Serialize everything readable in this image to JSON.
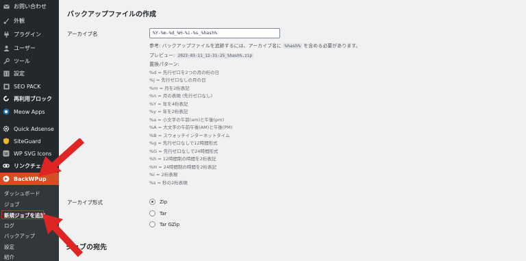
{
  "sidebar": {
    "items": [
      {
        "label": "お問い合わせ",
        "icon": "mail-icon"
      },
      {
        "label": "外観",
        "icon": "brush-icon"
      },
      {
        "label": "プラグイン",
        "icon": "plugin-icon"
      },
      {
        "label": "ユーザー",
        "icon": "user-icon"
      },
      {
        "label": "ツール",
        "icon": "wrench-icon"
      },
      {
        "label": "設定",
        "icon": "settings-icon"
      },
      {
        "label": "SEO PACK",
        "icon": "seo-icon"
      },
      {
        "label": "再利用ブロック",
        "icon": "reuse-icon"
      },
      {
        "label": "Meow Apps",
        "icon": "meow-icon"
      },
      {
        "label": "Quick Adsense",
        "icon": "gear-icon"
      },
      {
        "label": "SiteGuard",
        "icon": "shield-icon"
      },
      {
        "label": "WP SVG Icons",
        "icon": "svg-icon"
      },
      {
        "label": "リンクチェッカー",
        "icon": "link-icon"
      },
      {
        "label": "BackWPup",
        "icon": "backwpup-icon"
      }
    ],
    "submenu": [
      "ダッシュボード",
      "ジョブ",
      "新規ジョブを追加",
      "ログ",
      "バックアップ",
      "設定",
      "紹介"
    ]
  },
  "main": {
    "section_title": "バックアップファイルの作成",
    "archive_name_label": "アーカイブ名",
    "archive_name_value": "%Y-%m-%d_%H-%i-%s_%hash%",
    "note_prefix": "参考: バックアップファイルを追跡するには、アーカイブ名に ",
    "note_code": "%hash%",
    "note_suffix": " を含める必要があります。",
    "preview_label": "プレビュー: ",
    "preview_value": "2023-03-11_12-31-25_%hash%.zip",
    "pattern_title": "置換パターン:",
    "patterns": [
      "%d = 先行ゼロを2つの月の桁の日",
      "%j = 先行ゼロなしの月の日",
      "%m = 月を2桁表記",
      "%n = 月の表現 (先行ゼロなし)",
      "%Y = 年を4桁表記",
      "%y = 年を2桁表記",
      "%a = 小文字の午前(am)と午後(pm)",
      "%A = 大文字の午前午後(AM)と午後(PM)",
      "%B = スウォッチインターネットタイム",
      "%g = 先行ゼロなしで12時間形式",
      "%G = 先行ゼロなしで24時間形式",
      "%h = 12時間制の時間を2桁表記",
      "%H = 24時間制の時間を2桁表記",
      "%i = 2桁表現",
      "%s = 秒の2桁表現"
    ],
    "archive_format_label": "アーカイブ形式",
    "formats": [
      "Zip",
      "Tar",
      "Tar GZip"
    ],
    "selected_format": "Zip",
    "next_section_title": "ジョブの宛先"
  },
  "colors": {
    "sidebar_bg": "#23282d",
    "active_bg": "#d54e21",
    "arrow": "#e02424"
  }
}
